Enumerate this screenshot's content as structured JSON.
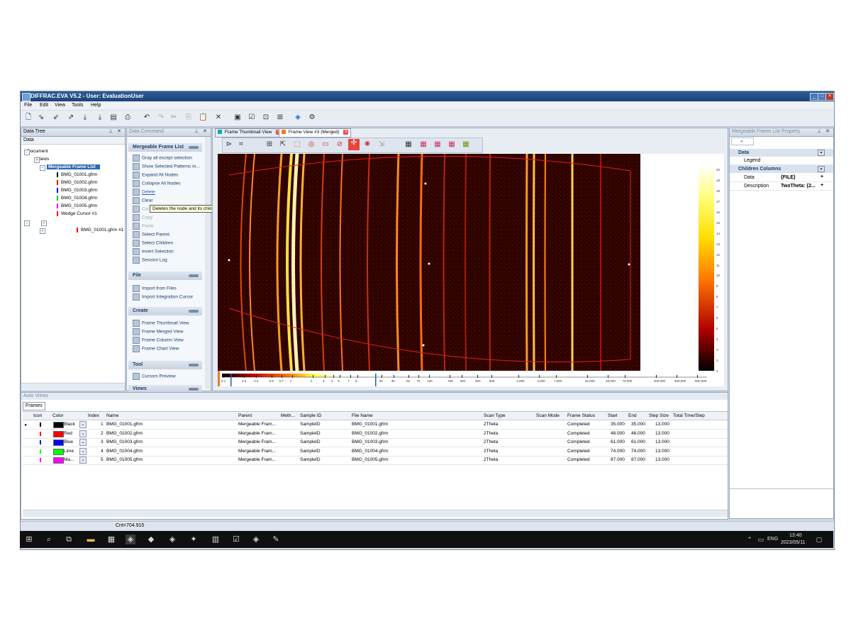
{
  "window": {
    "title": "DIFFRAC.EVA V5.2 - User: EvaluationUser"
  },
  "menu": [
    "File",
    "Edit",
    "View",
    "Tools",
    "Help"
  ],
  "data_tree": {
    "title": "Data Tree",
    "header": "Data",
    "items": [
      {
        "label": "Document",
        "indent": 0
      },
      {
        "label": "Views",
        "indent": 1
      },
      {
        "label": "Mergeable Frame List",
        "indent": 2,
        "selected": true
      },
      {
        "label": "BMG_01001.gfrm",
        "indent": 3,
        "color": "#000000"
      },
      {
        "label": "BMG_01002.gfrm",
        "indent": 3,
        "color": "#ff0000"
      },
      {
        "label": "BMG_01003.gfrm",
        "indent": 3,
        "color": "#0000ff"
      },
      {
        "label": "BMG_01004.gfrm",
        "indent": 3,
        "color": "#00cc00"
      },
      {
        "label": "BMG_01005.gfrm",
        "indent": 3,
        "color": "#ff00ff"
      },
      {
        "label": "Wedge Cursor #1",
        "indent": 3,
        "color": "#ff0000"
      },
      {
        "label": "BMG_01001.gfrm #1",
        "indent": 3,
        "color": "#ff0000"
      }
    ]
  },
  "data_command": {
    "title": "Data Command",
    "sections": [
      {
        "title": "Mergeable Frame List",
        "items": [
          {
            "label": "Gray all except selection"
          },
          {
            "label": "Show Selected Patterns in..."
          },
          {
            "label": "Expand All Nodes"
          },
          {
            "label": "Collapse All Nodes"
          },
          {
            "label": "Delete",
            "link": true
          },
          {
            "label": "Clear"
          },
          {
            "label": "Cut",
            "disabled": true
          },
          {
            "label": "Copy",
            "disabled": true
          },
          {
            "label": "Paste",
            "disabled": true
          },
          {
            "label": "Select Parent"
          },
          {
            "label": "Select Children"
          },
          {
            "label": "Invert Selection"
          },
          {
            "label": "Session Log"
          }
        ]
      },
      {
        "title": "File",
        "items": [
          {
            "label": "Import from Files"
          },
          {
            "label": "Import Integration Cursor"
          }
        ]
      },
      {
        "title": "Create",
        "items": [
          {
            "label": "Frame Thumbnail View"
          },
          {
            "label": "Frame Merged View"
          },
          {
            "label": "Frame Column View"
          },
          {
            "label": "Frame Chart View"
          }
        ]
      },
      {
        "title": "Tool",
        "items": [
          {
            "label": "Cursors Preview"
          }
        ]
      },
      {
        "title": "Views",
        "items": []
      }
    ],
    "tooltip": "Deletes the node and its children."
  },
  "tabs": [
    {
      "label": "Frame Thumbnail View",
      "active": false
    },
    {
      "label": "Frame View #3 (Merged)",
      "active": true
    }
  ],
  "colorbar": {
    "ticks": [
      "0.1",
      "0.2",
      "0.3",
      "0.5",
      "0.7",
      "1",
      "2",
      "3",
      "4",
      "5",
      "7",
      "9",
      "20",
      "30",
      "50",
      "70",
      "100",
      "200",
      "300",
      "500",
      "800",
      "2,000",
      "4,000",
      "7,000",
      "20,000",
      "40,000",
      "70,000",
      "200,000",
      "400,000",
      "800,000"
    ],
    "vertical_ticks": [
      "20",
      "19",
      "18",
      "17",
      "16",
      "15",
      "14",
      "13",
      "12",
      "11",
      "10",
      "9",
      "8",
      "7",
      "6",
      "5",
      "4",
      "3",
      "2",
      "1"
    ]
  },
  "property": {
    "title": "Mergeable Frame List Property",
    "section": "Data",
    "legend": "Legend",
    "children_columns": "Children Columns",
    "rows": [
      {
        "name": "Data",
        "value": "{FILE}"
      },
      {
        "name": "Description",
        "value": "TwoTheta: {2..."
      }
    ]
  },
  "auto_views": {
    "title": "Auto Views",
    "tab": "Frames",
    "columns": [
      "Icon",
      "Color",
      "Index",
      "Name",
      "Parent",
      "Meth...",
      "Sample ID",
      "File Name",
      "Scan Type",
      "Scan Mode",
      "Frame Status",
      "Start",
      "End",
      "Step Size",
      "Total Time/Step"
    ],
    "rows": [
      {
        "color_name": "Black",
        "color": "#000000",
        "index": "1",
        "name": "BMG_01001.gfrm",
        "parent": "Mergeable Fram...",
        "sample": "SampleID",
        "file": "BMG_01001.gfrm",
        "scan": "2Theta",
        "status": "Completed",
        "start": "35.000",
        "end": "35.000",
        "step": "13.000"
      },
      {
        "color_name": "Red",
        "color": "#ff0000",
        "index": "2",
        "name": "BMG_01002.gfrm",
        "parent": "Mergeable Fram...",
        "sample": "SampleID",
        "file": "BMG_01002.gfrm",
        "scan": "2Theta",
        "status": "Completed",
        "start": "48.000",
        "end": "48.000",
        "step": "13.000"
      },
      {
        "color_name": "Blue",
        "color": "#0000ff",
        "index": "3",
        "name": "BMG_01003.gfrm",
        "parent": "Mergeable Fram...",
        "sample": "SampleID",
        "file": "BMG_01003.gfrm",
        "scan": "2Theta",
        "status": "Completed",
        "start": "61.000",
        "end": "61.000",
        "step": "13.000"
      },
      {
        "color_name": "Lime",
        "color": "#00ff00",
        "index": "4",
        "name": "BMG_01004.gfrm",
        "parent": "Mergeable Fram...",
        "sample": "SampleID",
        "file": "BMG_01004.gfrm",
        "scan": "2Theta",
        "status": "Completed",
        "start": "74.000",
        "end": "74.000",
        "step": "13.000"
      },
      {
        "color_name": "Ma...",
        "color": "#ff00ff",
        "index": "5",
        "name": "BMG_01005.gfrm",
        "parent": "Mergeable Fram...",
        "sample": "SampleID",
        "file": "BMG_01005.gfrm",
        "scan": "2Theta",
        "status": "Completed",
        "start": "87.000",
        "end": "87.000",
        "step": "13.000"
      }
    ]
  },
  "status": {
    "count": "Cnt=704.915"
  },
  "taskbar": {
    "lang": "ENG",
    "time": "13:40",
    "date": "2023/05/11"
  }
}
